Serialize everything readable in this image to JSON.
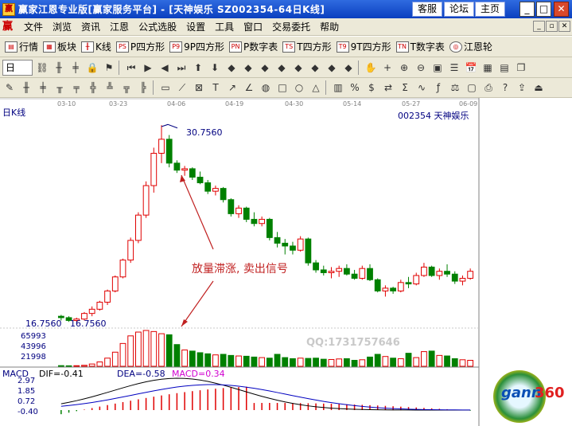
{
  "window": {
    "title": "赢家江恩专业版[赢家服务平台] - [天神娱乐   SZ002354-64日K线]",
    "buttons": [
      "客服",
      "论坛",
      "主页"
    ]
  },
  "menu": [
    "文件",
    "浏览",
    "资讯",
    "江恩",
    "公式选股",
    "设置",
    "工具",
    "窗口",
    "交易委托",
    "帮助"
  ],
  "toolbar1": [
    {
      "icon": "market-icon",
      "label": "行情"
    },
    {
      "icon": "block-icon",
      "label": "板块"
    },
    {
      "icon": "kline-icon",
      "label": "K线"
    },
    {
      "icon": "p-square-icon",
      "label": "P四方形",
      "tag": "PS"
    },
    {
      "icon": "9p-square-icon",
      "label": "9P四方形",
      "tag": "P9"
    },
    {
      "icon": "p-number-table-icon",
      "label": "P数字表",
      "tag": "PN"
    },
    {
      "icon": "t-square-icon",
      "label": "T四方形",
      "tag": "TS"
    },
    {
      "icon": "9t-square-icon",
      "label": "9T四方形",
      "tag": "T9"
    },
    {
      "icon": "t-number-table-icon",
      "label": "T数字表",
      "tag": "TN"
    },
    {
      "icon": "gann-wheel-icon",
      "label": "江恩轮"
    }
  ],
  "toolbar2_period": "日",
  "chart": {
    "period_label": "日K线",
    "stock_label": "002354  天神娱乐",
    "high_label": "30.7560",
    "low_label_left": "16.7560",
    "low_label_right": "16.7560",
    "annotation": "放量滞涨, 卖出信号",
    "watermark": "QQ:1731757646",
    "volume_ticks": [
      "65993",
      "43996",
      "21998"
    ],
    "date_ticks": [
      "03-10",
      "03-23",
      "04-06",
      "04-19",
      "04-30",
      "05-14",
      "05-27",
      "06-09"
    ],
    "macd": {
      "title": "MACD",
      "dif": "DIF=-0.41",
      "dea": "DEA=-0.58",
      "macd": "MACD=0.34",
      "ticks": [
        "2.97",
        "1.85",
        "0.72",
        "-0.40"
      ]
    },
    "logo_text": "gann",
    "logo_num": "360"
  },
  "colors": {
    "up": "#e00000",
    "down": "#008000",
    "axis": "#000080",
    "annotation": "#c02020"
  },
  "chart_data": {
    "type": "candlestick",
    "ylim": [
      16.756,
      30.756
    ],
    "candles": [
      [
        17.2,
        17.3,
        16.9,
        17.1
      ],
      [
        17.1,
        17.2,
        16.8,
        16.9
      ],
      [
        16.9,
        17.1,
        16.8,
        17.0
      ],
      [
        17.0,
        17.5,
        16.9,
        17.4
      ],
      [
        17.4,
        17.9,
        17.2,
        17.7
      ],
      [
        17.7,
        18.3,
        17.6,
        18.2
      ],
      [
        18.2,
        19.1,
        18.0,
        19.0
      ],
      [
        19.0,
        20.1,
        18.9,
        20.0
      ],
      [
        20.0,
        21.3,
        19.9,
        21.2
      ],
      [
        21.2,
        22.8,
        21.0,
        22.6
      ],
      [
        22.6,
        24.6,
        22.4,
        24.4
      ],
      [
        24.4,
        26.8,
        24.2,
        26.5
      ],
      [
        26.5,
        29.2,
        26.0,
        28.8
      ],
      [
        28.8,
        30.8,
        28.1,
        29.8
      ],
      [
        29.8,
        30.1,
        27.8,
        28.1
      ],
      [
        28.1,
        28.3,
        27.4,
        27.6
      ],
      [
        27.6,
        27.9,
        27.2,
        27.7
      ],
      [
        27.7,
        27.8,
        26.9,
        27.1
      ],
      [
        27.1,
        27.5,
        26.6,
        26.7
      ],
      [
        26.7,
        26.9,
        25.9,
        26.1
      ],
      [
        26.1,
        26.5,
        25.8,
        26.3
      ],
      [
        26.3,
        26.4,
        25.3,
        25.5
      ],
      [
        25.5,
        25.6,
        24.3,
        24.5
      ],
      [
        24.5,
        25.1,
        24.2,
        24.9
      ],
      [
        24.9,
        25.0,
        23.9,
        24.1
      ],
      [
        24.1,
        24.6,
        23.6,
        23.8
      ],
      [
        23.8,
        24.3,
        23.6,
        24.1
      ],
      [
        24.1,
        24.2,
        22.6,
        22.8
      ],
      [
        22.8,
        23.2,
        22.1,
        22.4
      ],
      [
        22.4,
        22.7,
        21.6,
        22.2
      ],
      [
        22.2,
        22.5,
        21.6,
        21.9
      ],
      [
        21.9,
        22.9,
        21.8,
        22.7
      ],
      [
        22.7,
        22.8,
        20.8,
        21.0
      ],
      [
        21.0,
        21.2,
        20.3,
        20.5
      ],
      [
        20.5,
        20.8,
        20.1,
        20.3
      ],
      [
        20.3,
        20.7,
        19.9,
        20.4
      ],
      [
        20.4,
        20.8,
        20.0,
        20.6
      ],
      [
        20.6,
        20.9,
        20.1,
        20.2
      ],
      [
        20.2,
        20.5,
        19.8,
        19.9
      ],
      [
        19.9,
        20.8,
        19.8,
        20.6
      ],
      [
        20.6,
        20.9,
        19.7,
        19.8
      ],
      [
        19.8,
        19.9,
        18.9,
        19.0
      ],
      [
        19.0,
        19.4,
        18.6,
        19.2
      ],
      [
        19.2,
        19.3,
        18.8,
        19.0
      ],
      [
        19.0,
        19.8,
        18.9,
        19.6
      ],
      [
        19.6,
        20.0,
        19.2,
        19.5
      ],
      [
        19.5,
        20.3,
        19.4,
        20.1
      ],
      [
        20.1,
        21.0,
        20.0,
        20.7
      ],
      [
        20.7,
        20.8,
        20.0,
        20.1
      ],
      [
        20.1,
        20.6,
        19.8,
        20.4
      ],
      [
        20.4,
        20.9,
        20.0,
        20.2
      ],
      [
        20.2,
        20.4,
        19.5,
        19.7
      ],
      [
        19.7,
        20.1,
        19.4,
        19.9
      ],
      [
        19.9,
        20.6,
        19.8,
        20.4
      ]
    ],
    "volume": [
      1200,
      900,
      1100,
      1800,
      4200,
      8000,
      15000,
      26000,
      42000,
      56000,
      63000,
      65993,
      64000,
      60000,
      58000,
      40000,
      30000,
      28000,
      25000,
      23000,
      21000,
      22000,
      20000,
      19000,
      18500,
      17000,
      16000,
      15000,
      21998,
      16000,
      14000,
      15000,
      14500,
      15000,
      13000,
      12500,
      13500,
      14000,
      11000,
      12000,
      17000,
      21998,
      18000,
      15000,
      14000,
      24000,
      16000,
      27000,
      28000,
      20000,
      19000,
      14000,
      12000,
      11000
    ]
  }
}
